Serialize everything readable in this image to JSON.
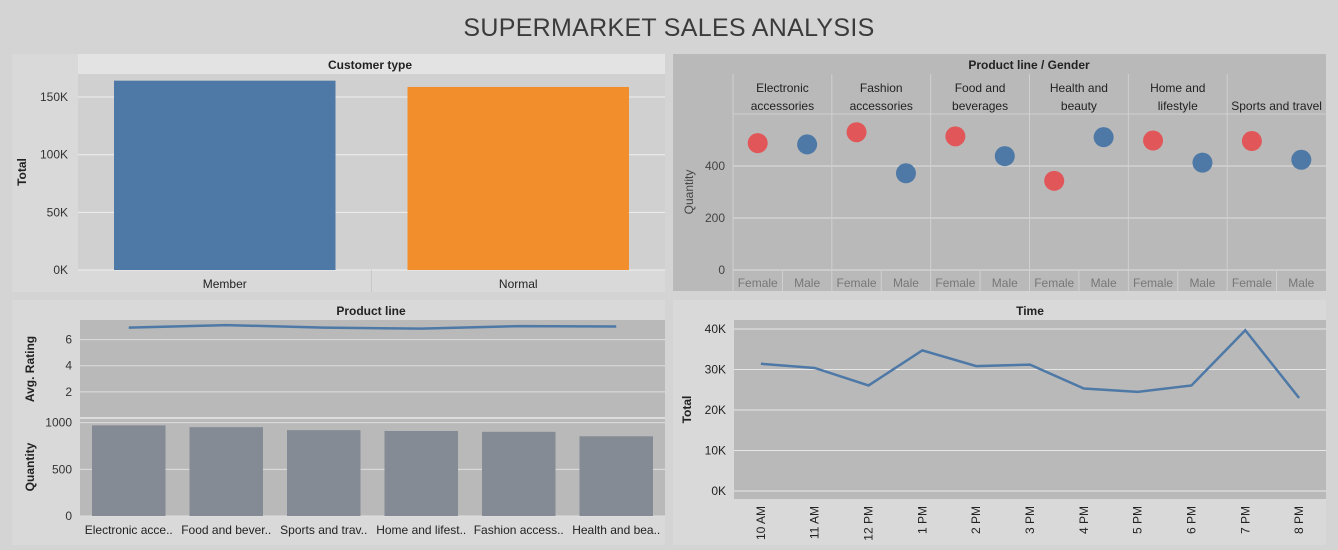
{
  "page": {
    "title": "SUPERMARKET SALES ANALYSIS"
  },
  "colors": {
    "background": "#d4d4d4",
    "panel_gray": "#b9b9b9",
    "blue": "#4e79a7",
    "orange": "#f28e2b",
    "red": "#e15759",
    "bar_gray": "#848b94"
  },
  "chart_data": [
    {
      "type": "bar",
      "title": "Customer type",
      "categories": [
        "Member",
        "Normal"
      ],
      "values": [
        164224,
        158743
      ],
      "colors": [
        "#4e79a7",
        "#f28e2b"
      ],
      "ylabel": "Total",
      "ylim": [
        0,
        170000
      ],
      "yticks": [
        0,
        50000,
        100000,
        150000
      ],
      "ytick_labels": [
        "0K",
        "50K",
        "100K",
        "150K"
      ],
      "grid": true
    },
    {
      "type": "scatter",
      "title": "Product line  /  Gender",
      "categories": [
        "Electronic accessories",
        "Fashion accessories",
        "Food and beverages",
        "Health and beauty",
        "Home and lifestyle",
        "Sports and travel"
      ],
      "category_lines": [
        [
          "Electronic",
          "accessories"
        ],
        [
          "Fashion",
          "accessories"
        ],
        [
          "Food and",
          "beverages"
        ],
        [
          "Health and",
          "beauty"
        ],
        [
          "Home and",
          "lifestyle"
        ],
        [
          "Sports and travel"
        ]
      ],
      "genders": [
        "Female",
        "Male"
      ],
      "series": [
        {
          "name": "Female",
          "color": "#e15759",
          "values": [
            488,
            530,
            514,
            343,
            498,
            496
          ]
        },
        {
          "name": "Male",
          "color": "#4e79a7",
          "values": [
            483,
            372,
            438,
            511,
            413,
            424
          ]
        }
      ],
      "ylabel": "Quantity",
      "ylim": [
        0,
        600
      ],
      "yticks": [
        0,
        200,
        400
      ],
      "grid": true
    },
    {
      "type": "bar",
      "title": "Product line",
      "categories": [
        "Electronic accessories",
        "Food and beverages",
        "Sports and travel",
        "Home and lifestyle",
        "Fashion accessories",
        "Health and beauty"
      ],
      "category_labels": [
        "Electronic acce..",
        "Food and bever..",
        "Sports and trav..",
        "Home and lifest..",
        "Fashion access..",
        "Health and bea.."
      ],
      "series": [
        {
          "name": "Avg. Rating",
          "type": "line",
          "color": "#4e79a7",
          "values": [
            6.92,
            7.11,
            6.92,
            6.84,
            7.03,
            7.0
          ]
        },
        {
          "name": "Quantity",
          "type": "bar",
          "color": "#848b94",
          "values": [
            971,
            952,
            920,
            911,
            902,
            854
          ]
        }
      ],
      "rating_axis": {
        "label": "Avg. Rating",
        "ylim": [
          0,
          7.5
        ],
        "yticks": [
          2,
          4,
          6
        ]
      },
      "quantity_axis": {
        "label": "Quantity",
        "ylim": [
          0,
          1050
        ],
        "yticks": [
          0,
          500,
          1000
        ]
      },
      "grid": true
    },
    {
      "type": "line",
      "title": "Time",
      "x": [
        "10 AM",
        "11 AM",
        "12 PM",
        "1 PM",
        "2 PM",
        "3 PM",
        "4 PM",
        "5 PM",
        "6 PM",
        "7 PM",
        "8 PM"
      ],
      "series": [
        {
          "name": "Total",
          "color": "#4e79a7",
          "values": [
            31420,
            30380,
            26060,
            34720,
            30840,
            31200,
            25300,
            24470,
            26060,
            39700,
            22970
          ]
        }
      ],
      "ylabel": "Total",
      "ylim": [
        0,
        40000
      ],
      "yticks": [
        0,
        10000,
        20000,
        30000,
        40000
      ],
      "ytick_labels": [
        "0K",
        "10K",
        "20K",
        "30K",
        "40K"
      ],
      "grid": true
    }
  ]
}
